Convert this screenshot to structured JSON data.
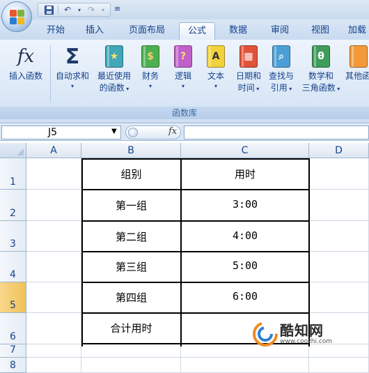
{
  "app": {
    "quick_access_more": "≡"
  },
  "tabs": [
    {
      "label": "开始"
    },
    {
      "label": "插入"
    },
    {
      "label": "页面布局"
    },
    {
      "label": "公式",
      "active": true
    },
    {
      "label": "数据"
    },
    {
      "label": "审阅"
    },
    {
      "label": "视图"
    },
    {
      "label": "加载"
    }
  ],
  "ribbon": {
    "group_label": "函数库",
    "buttons": [
      {
        "name": "insert-function",
        "line1": "插入函数",
        "line2": "",
        "icon": "fx-icon",
        "icon_text": "fx"
      },
      {
        "name": "autosum",
        "line1": "自动求和",
        "line2": "",
        "icon": "sigma-icon",
        "icon_text": "Σ"
      },
      {
        "name": "recently-used",
        "line1": "最近使用",
        "line2": "的函数",
        "icon": "star-book-icon",
        "icon_text": "★"
      },
      {
        "name": "financial",
        "line1": "财务",
        "line2": "",
        "icon": "finance-book-icon",
        "icon_text": "$"
      },
      {
        "name": "logical",
        "line1": "逻辑",
        "line2": "",
        "icon": "question-book-icon",
        "icon_text": "?"
      },
      {
        "name": "text",
        "line1": "文本",
        "line2": "",
        "icon": "text-book-icon",
        "icon_text": "A"
      },
      {
        "name": "date-time",
        "line1": "日期和",
        "line2": "时间",
        "icon": "calendar-book-icon",
        "icon_text": "▦"
      },
      {
        "name": "lookup-reference",
        "line1": "查找与",
        "line2": "引用",
        "icon": "magnifier-book-icon",
        "icon_text": "⌕"
      },
      {
        "name": "math-trig",
        "line1": "数学和",
        "line2": "三角函数",
        "icon": "theta-book-icon",
        "icon_text": "θ"
      },
      {
        "name": "more-functions",
        "line1": "其他函",
        "line2": "",
        "icon": "more-book-icon",
        "icon_text": ""
      }
    ],
    "colors": {
      "sigma": "#1f3a6b",
      "star": "#3fa7b8",
      "finance": "#4caf50",
      "question": "#c060c8",
      "text": "#f2d23a",
      "calendar": "#e0533a",
      "magnifier": "#4a9fd6",
      "theta": "#3f9c5a",
      "more": "#f29a3a"
    }
  },
  "formula_bar": {
    "name_box": "J5",
    "fx_label": "fx",
    "formula": ""
  },
  "sheet": {
    "columns": [
      "A",
      "B",
      "C",
      "D"
    ],
    "rows": [
      "1",
      "2",
      "3",
      "4",
      "5",
      "6",
      "7",
      "8"
    ],
    "selected_row": "5",
    "table": {
      "header": [
        "组别",
        "用时"
      ],
      "rows": [
        [
          "第一组",
          "3:00"
        ],
        [
          "第二组",
          "4:00"
        ],
        [
          "第三组",
          "5:00"
        ],
        [
          "第四组",
          "6:00"
        ],
        [
          "合计用时",
          ""
        ]
      ]
    }
  },
  "watermark": {
    "name": "酷知网",
    "url": "www.coozhi.com"
  }
}
